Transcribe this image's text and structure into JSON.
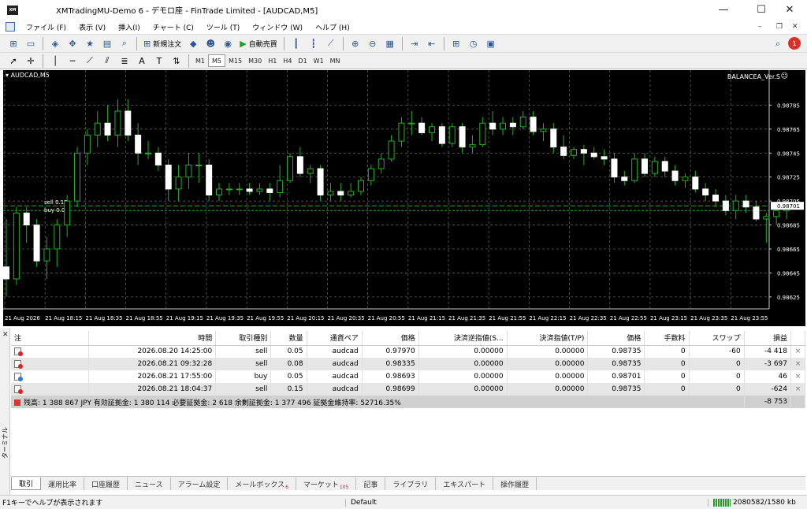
{
  "window": {
    "title": "XMTradingMU-Demo 6 - デモロ座 - FinTrade Limited - [AUDCAD,M5]",
    "logo": "XM",
    "minimize": "—",
    "maximize": "☐",
    "close": "✕"
  },
  "menu": [
    "ファイル (F)",
    "表示 (V)",
    "挿入(I)",
    "チャート (C)",
    "ツール (T)",
    "ウィンドウ (W)",
    "ヘルプ (H)"
  ],
  "toolbar": {
    "new_order": "新規注文",
    "auto_trade": "自動売買",
    "timeframes": [
      "M1",
      "M5",
      "M15",
      "M30",
      "H1",
      "H4",
      "D1",
      "W1",
      "MN"
    ],
    "active_timeframe": "M5",
    "notification_count": "1"
  },
  "chart": {
    "symbol": "AUDCAD,M5",
    "ea_name": "BALANCEA_Ver.S",
    "order_labels": [
      "sell 0.15",
      "buy 0.0"
    ]
  },
  "chart_data": {
    "type": "candlestick",
    "ylim": [
      0.98615,
      0.98805
    ],
    "y_ticks": [
      "0.98785",
      "0.98765",
      "0.98745",
      "0.98725",
      "0.98705",
      "0.98685",
      "0.98665",
      "0.98645",
      "0.98625"
    ],
    "x_ticks": [
      "21 Aug 2026",
      "21 Aug 18:15",
      "21 Aug 18:35",
      "21 Aug 18:55",
      "21 Aug 19:15",
      "21 Aug 19:35",
      "21 Aug 19:55",
      "21 Aug 20:15",
      "21 Aug 20:35",
      "21 Aug 20:55",
      "21 Aug 21:15",
      "21 Aug 21:35",
      "21 Aug 21:55",
      "21 Aug 22:15",
      "21 Aug 22:35",
      "21 Aug 22:55",
      "21 Aug 23:15",
      "21 Aug 23:35",
      "21 Aug 23:55"
    ],
    "current_price": "0.98701",
    "order_levels": [
      0.98701,
      0.98697
    ],
    "candles": [
      [
        0.9865,
        0.9869,
        0.98625,
        0.9864
      ],
      [
        0.9864,
        0.987,
        0.98635,
        0.98695
      ],
      [
        0.98695,
        0.987,
        0.9867,
        0.98685
      ],
      [
        0.98685,
        0.9869,
        0.9865,
        0.98655
      ],
      [
        0.98655,
        0.98675,
        0.9864,
        0.98665
      ],
      [
        0.98665,
        0.9869,
        0.9865,
        0.98685
      ],
      [
        0.98685,
        0.9871,
        0.98675,
        0.98705
      ],
      [
        0.98705,
        0.9875,
        0.987,
        0.98745
      ],
      [
        0.98745,
        0.98765,
        0.98735,
        0.9876
      ],
      [
        0.9876,
        0.9878,
        0.9875,
        0.9877
      ],
      [
        0.9877,
        0.98785,
        0.98755,
        0.9876
      ],
      [
        0.9876,
        0.9879,
        0.9875,
        0.9878
      ],
      [
        0.9878,
        0.9879,
        0.98755,
        0.9876
      ],
      [
        0.9876,
        0.9877,
        0.98735,
        0.98745
      ],
      [
        0.98745,
        0.98755,
        0.9874,
        0.98745
      ],
      [
        0.98745,
        0.9875,
        0.9873,
        0.98735
      ],
      [
        0.98735,
        0.9874,
        0.98705,
        0.98715
      ],
      [
        0.98715,
        0.98735,
        0.98705,
        0.98725
      ],
      [
        0.98725,
        0.98745,
        0.98715,
        0.98735
      ],
      [
        0.98735,
        0.98745,
        0.9872,
        0.98735
      ],
      [
        0.98735,
        0.9874,
        0.98705,
        0.9871
      ],
      [
        0.9871,
        0.9872,
        0.98705,
        0.98715
      ],
      [
        0.98715,
        0.9872,
        0.9871,
        0.98715
      ],
      [
        0.98715,
        0.9872,
        0.9871,
        0.98715
      ],
      [
        0.98715,
        0.9872,
        0.9871,
        0.98713
      ],
      [
        0.98713,
        0.9872,
        0.9871,
        0.98715
      ],
      [
        0.98715,
        0.9872,
        0.98705,
        0.98712
      ],
      [
        0.98712,
        0.98735,
        0.98708,
        0.98722
      ],
      [
        0.98722,
        0.98745,
        0.9872,
        0.98742
      ],
      [
        0.98742,
        0.9875,
        0.98725,
        0.98728
      ],
      [
        0.98728,
        0.98735,
        0.9872,
        0.98732
      ],
      [
        0.98732,
        0.98735,
        0.98705,
        0.9871
      ],
      [
        0.9871,
        0.9872,
        0.98705,
        0.98713
      ],
      [
        0.98713,
        0.9872,
        0.98705,
        0.9871
      ],
      [
        0.9871,
        0.9872,
        0.98708,
        0.98713
      ],
      [
        0.98713,
        0.98725,
        0.9871,
        0.98722
      ],
      [
        0.98722,
        0.98735,
        0.98718,
        0.98732
      ],
      [
        0.98732,
        0.98745,
        0.98728,
        0.9874
      ],
      [
        0.9874,
        0.9876,
        0.98738,
        0.98755
      ],
      [
        0.98755,
        0.98775,
        0.9875,
        0.9877
      ],
      [
        0.9877,
        0.9878,
        0.9876,
        0.9877
      ],
      [
        0.9877,
        0.98775,
        0.9876,
        0.98762
      ],
      [
        0.98762,
        0.9877,
        0.98755,
        0.98767
      ],
      [
        0.98767,
        0.9877,
        0.9875,
        0.98753
      ],
      [
        0.98753,
        0.9877,
        0.9875,
        0.98767
      ],
      [
        0.98767,
        0.9877,
        0.98745,
        0.9875
      ],
      [
        0.9875,
        0.9876,
        0.98745,
        0.98752
      ],
      [
        0.98752,
        0.98775,
        0.9875,
        0.9877
      ],
      [
        0.9877,
        0.9878,
        0.9876,
        0.98765
      ],
      [
        0.98765,
        0.98775,
        0.9876,
        0.9877
      ],
      [
        0.9877,
        0.98775,
        0.9876,
        0.98767
      ],
      [
        0.98767,
        0.9878,
        0.98765,
        0.98775
      ],
      [
        0.98775,
        0.9878,
        0.9876,
        0.98763
      ],
      [
        0.98763,
        0.9877,
        0.98755,
        0.98765
      ],
      [
        0.98765,
        0.9877,
        0.98745,
        0.9875
      ],
      [
        0.9875,
        0.9876,
        0.9874,
        0.98743
      ],
      [
        0.98743,
        0.9875,
        0.9874,
        0.98748
      ],
      [
        0.98748,
        0.98752,
        0.98735,
        0.98745
      ],
      [
        0.98745,
        0.9875,
        0.9874,
        0.98742
      ],
      [
        0.98742,
        0.98748,
        0.98735,
        0.9874
      ],
      [
        0.9874,
        0.98745,
        0.9872,
        0.98725
      ],
      [
        0.98725,
        0.9873,
        0.98718,
        0.98722
      ],
      [
        0.98722,
        0.98745,
        0.9872,
        0.9874
      ],
      [
        0.9874,
        0.98745,
        0.98725,
        0.98728
      ],
      [
        0.98728,
        0.98742,
        0.98725,
        0.98738
      ],
      [
        0.98738,
        0.98742,
        0.98725,
        0.9873
      ],
      [
        0.9873,
        0.98735,
        0.98718,
        0.98722
      ],
      [
        0.98722,
        0.98728,
        0.98716,
        0.98725
      ],
      [
        0.98725,
        0.9873,
        0.98712,
        0.98715
      ],
      [
        0.98715,
        0.9872,
        0.98705,
        0.9871
      ],
      [
        0.9871,
        0.98715,
        0.987,
        0.98705
      ],
      [
        0.98705,
        0.9871,
        0.98693,
        0.98697
      ],
      [
        0.98697,
        0.9871,
        0.9869,
        0.98705
      ],
      [
        0.98705,
        0.9871,
        0.98695,
        0.987
      ],
      [
        0.987,
        0.98705,
        0.98688,
        0.9869
      ],
      [
        0.9869,
        0.98695,
        0.9867,
        0.98692
      ],
      [
        0.98692,
        0.98702,
        0.98685,
        0.98697
      ],
      [
        0.98697,
        0.98703,
        0.9869,
        0.98701
      ]
    ]
  },
  "trades": {
    "headers": [
      "注",
      "時間",
      "取引種別",
      "数量",
      "通貨ペア",
      "価格",
      "決済逆指値(S...",
      "決済指値(T/P)",
      "価格",
      "手数料",
      "スワップ",
      "損益"
    ],
    "rows": [
      {
        "type": "sell",
        "time": "2026.08.20 14:25:00",
        "kind": "sell",
        "volume": "0.05",
        "symbol": "audcad",
        "price": "0.97970",
        "sl": "0.00000",
        "tp": "0.00000",
        "cur": "0.98735",
        "commission": "0",
        "swap": "-60",
        "profit": "-4 418"
      },
      {
        "type": "sell",
        "time": "2026.08.21 09:32:28",
        "kind": "sell",
        "volume": "0.08",
        "symbol": "audcad",
        "price": "0.98335",
        "sl": "0.00000",
        "tp": "0.00000",
        "cur": "0.98735",
        "commission": "0",
        "swap": "0",
        "profit": "-3 697"
      },
      {
        "type": "buy",
        "time": "2026.08.21 17:55:00",
        "kind": "buy",
        "volume": "0.05",
        "symbol": "audcad",
        "price": "0.98693",
        "sl": "0.00000",
        "tp": "0.00000",
        "cur": "0.98701",
        "commission": "0",
        "swap": "0",
        "profit": "46"
      },
      {
        "type": "sell",
        "time": "2026.08.21 18:04:37",
        "kind": "sell",
        "volume": "0.15",
        "symbol": "audcad",
        "price": "0.98699",
        "sl": "0.00000",
        "tp": "0.00000",
        "cur": "0.98735",
        "commission": "0",
        "swap": "0",
        "profit": "-624"
      }
    ],
    "summary": "残高: 1 388 867 JPY  有効証拠金: 1 380 114  必要証拠金: 2 618  余剰証拠金: 1 377 496  証拠金維持率: 52716.35%",
    "summary_profit": "-8 753",
    "close_glyph": "×"
  },
  "tabs": [
    {
      "label": "取引",
      "active": true
    },
    {
      "label": "運用比率"
    },
    {
      "label": "口座履歴"
    },
    {
      "label": "ニュース"
    },
    {
      "label": "アラーム設定"
    },
    {
      "label": "メールボックス",
      "badge": "6"
    },
    {
      "label": "マーケット",
      "badge": "105"
    },
    {
      "label": "記事"
    },
    {
      "label": "ライブラリ"
    },
    {
      "label": "エキスパート"
    },
    {
      "label": "操作履歴"
    }
  ],
  "terminal_label": "ターミナル",
  "status": {
    "help": "F1キーでヘルプが表示されます",
    "profile": "Default",
    "connection": "2080582/1580 kb"
  }
}
